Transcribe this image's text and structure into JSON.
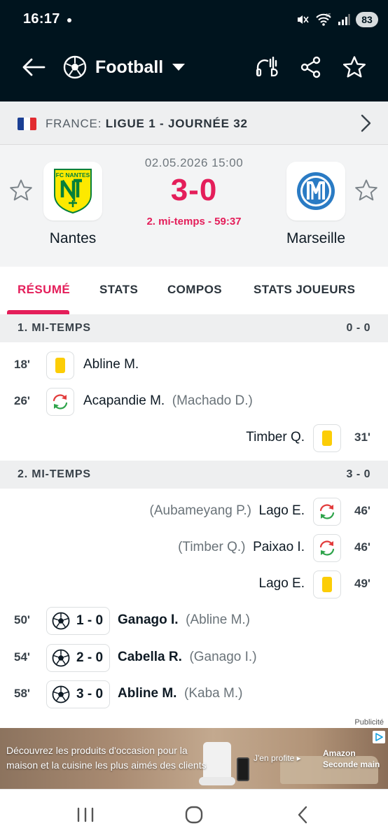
{
  "status_bar": {
    "time": "16:17",
    "battery": "83"
  },
  "app_bar": {
    "sport": "Football"
  },
  "league": {
    "country": "FRANCE:",
    "competition": "LIGUE 1 - JOURNÉE 32",
    "flag_colors": [
      "#1b3f94",
      "#ffffff",
      "#e22b30"
    ]
  },
  "match": {
    "date": "02.05.2026 15:00",
    "score": "3-0",
    "status": "2. mi-temps - 59:37",
    "home": {
      "name": "Nantes",
      "logo_text": "FC NANTES",
      "logo_color": "#fde900",
      "logo_accent": "#05803a"
    },
    "away": {
      "name": "Marseille",
      "logo_color": "#2a7bc4"
    }
  },
  "tabs": [
    "RÉSUMÉ",
    "STATS",
    "COMPOS",
    "STATS JOUEURS"
  ],
  "timeline": {
    "first_half": {
      "name": "1. MI-TEMPS",
      "score": "0 - 0",
      "events": [
        {
          "minute": "18'",
          "type": "yellow-card",
          "side": "home",
          "player": "Abline M.",
          "extra": ""
        },
        {
          "minute": "26'",
          "type": "substitution",
          "side": "home",
          "player": "Acapandie M.",
          "extra": "(Machado D.)"
        },
        {
          "minute": "31'",
          "type": "yellow-card",
          "side": "away",
          "player": "Timber Q.",
          "extra": ""
        }
      ]
    },
    "second_half": {
      "name": "2. MI-TEMPS",
      "score": "3 - 0",
      "events": [
        {
          "minute": "46'",
          "type": "substitution",
          "side": "away",
          "player": "Lago E.",
          "extra": "(Aubameyang P.)"
        },
        {
          "minute": "46'",
          "type": "substitution",
          "side": "away",
          "player": "Paixao I.",
          "extra": "(Timber Q.)"
        },
        {
          "minute": "49'",
          "type": "yellow-card",
          "side": "away",
          "player": "Lago E.",
          "extra": ""
        },
        {
          "minute": "50'",
          "type": "goal",
          "side": "home",
          "score": "1 - 0",
          "player": "Ganago I.",
          "extra": "(Abline M.)"
        },
        {
          "minute": "54'",
          "type": "goal",
          "side": "home",
          "score": "2 - 0",
          "player": "Cabella R.",
          "extra": "(Ganago I.)"
        },
        {
          "minute": "58'",
          "type": "goal",
          "side": "home",
          "score": "3 - 0",
          "player": "Abline M.",
          "extra": "(Kaba M.)"
        }
      ]
    }
  },
  "ad": {
    "label": "Publicité",
    "text": "Découvrez les produits d'occasion pour la maison et la cuisine les plus aimés des clients",
    "cta": "J'en profite ▸",
    "brand_line1": "Amazon",
    "brand_line2": "Seconde main"
  },
  "colors": {
    "accent": "#e41e5a",
    "header_bg": "#00141e",
    "yellow_card": "#fccd06",
    "sub_in": "#2ea34a",
    "sub_out": "#e23b3b"
  }
}
